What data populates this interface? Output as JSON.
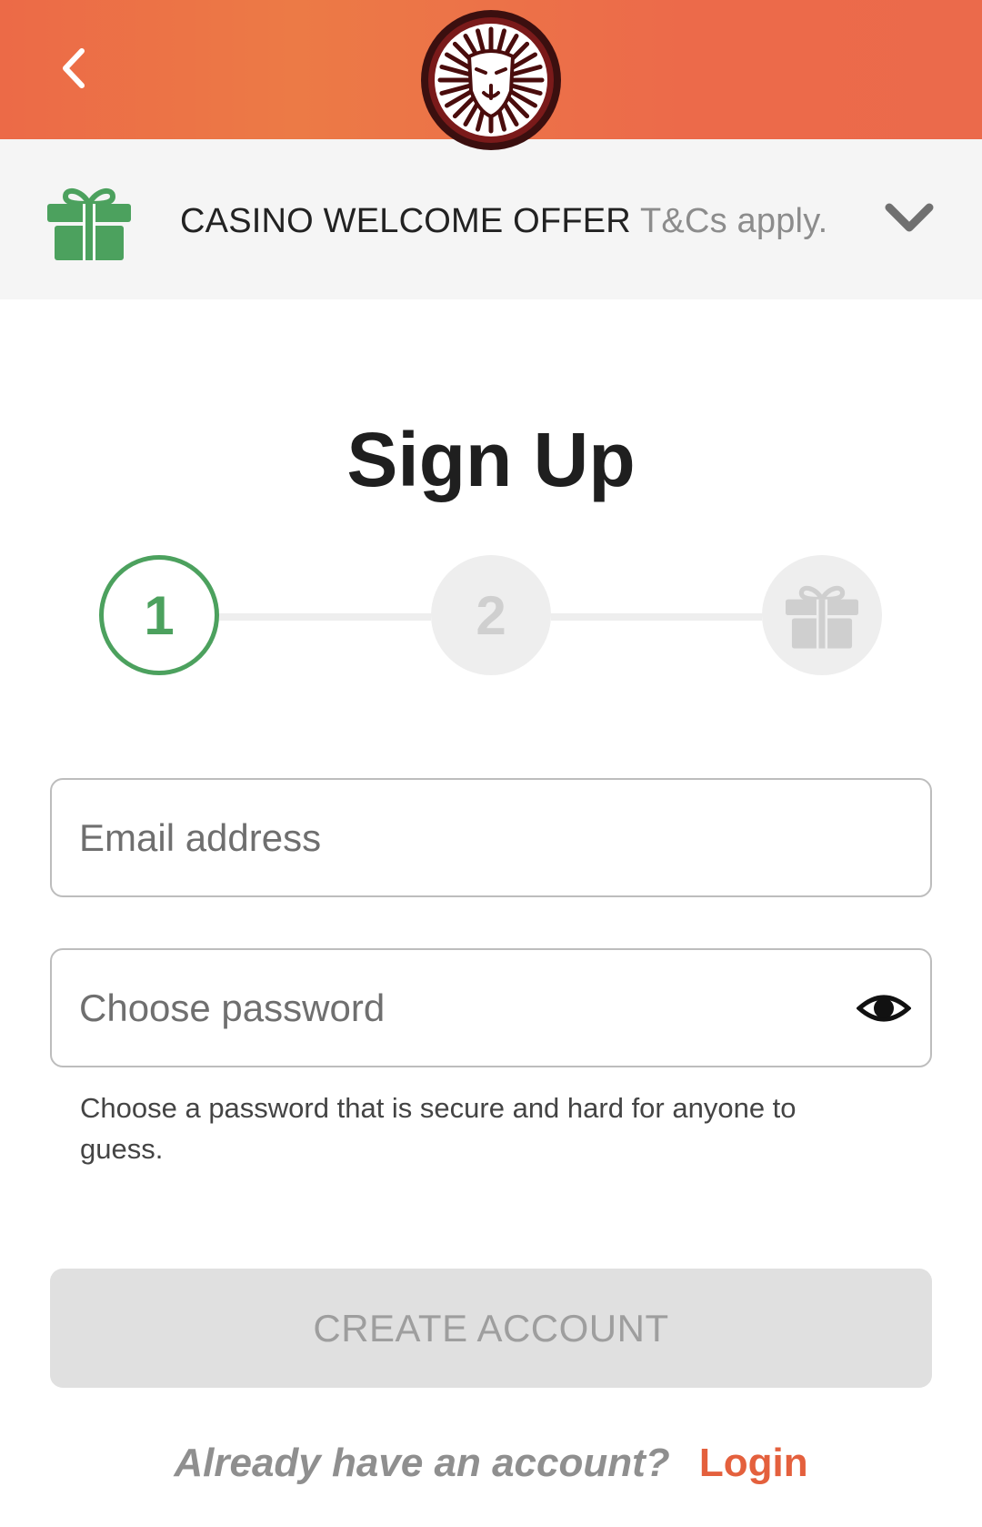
{
  "header": {
    "back_icon": "chevron-left-icon",
    "logo_icon": "lion-logo-icon",
    "background_color": "#ec6a47"
  },
  "promo": {
    "gift_icon": "gift-icon",
    "title": "CASINO WELCOME OFFER",
    "terms": "T&Cs apply.",
    "expand_icon": "chevron-down-icon",
    "gift_color": "#4ca15e"
  },
  "page": {
    "title": "Sign Up"
  },
  "stepper": {
    "steps": [
      {
        "label": "1",
        "state": "active"
      },
      {
        "label": "2",
        "state": "inactive"
      },
      {
        "icon": "gift-icon",
        "state": "inactive"
      }
    ],
    "active_color": "#4ca15e",
    "inactive_color": "#eeeeee"
  },
  "form": {
    "email": {
      "placeholder": "Email address",
      "value": ""
    },
    "password": {
      "placeholder": "Choose password",
      "value": "",
      "toggle_icon": "eye-icon",
      "hint": "Choose a password that is secure and hard for anyone to guess."
    },
    "submit_label": "CREATE ACCOUNT"
  },
  "footer": {
    "question": "Already have an account?",
    "login_label": "Login",
    "link_color": "#e4603d"
  }
}
